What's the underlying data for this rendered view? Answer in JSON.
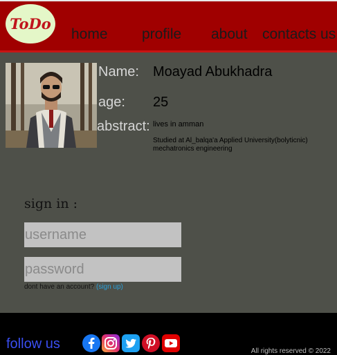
{
  "header": {
    "logo_text": "ToDo",
    "nav": {
      "home": "home",
      "profile": "profile",
      "about": "about",
      "contact": "contacts us"
    }
  },
  "profile": {
    "name_label": "Name:",
    "name_value": "Moayad Abukhadra",
    "age_label": "age:",
    "age_value": "25",
    "abstract_label": "abstract:",
    "abstract_location": "lives in amman",
    "abstract_study": "Studied at Al_balqa'a Applied University(bolyticnic) mechatronics engineering"
  },
  "signin": {
    "title": "sign in :",
    "username_placeholder": "username",
    "password_placeholder": "password",
    "no_account_text": "dont have an account?",
    "signup_link": "(sign up)"
  },
  "footer": {
    "follow_label": "follow us",
    "social_icons": [
      "facebook-icon",
      "instagram-icon",
      "twitter-icon",
      "pinterest-icon",
      "youtube-icon"
    ],
    "copyright": "All rights reserved © 2022"
  },
  "colors": {
    "header_bg": "#a00000",
    "main_bg": "#4e5049",
    "footer_bg": "#000000",
    "follow_text": "#3a4ef0",
    "link": "#2a9fd8"
  }
}
